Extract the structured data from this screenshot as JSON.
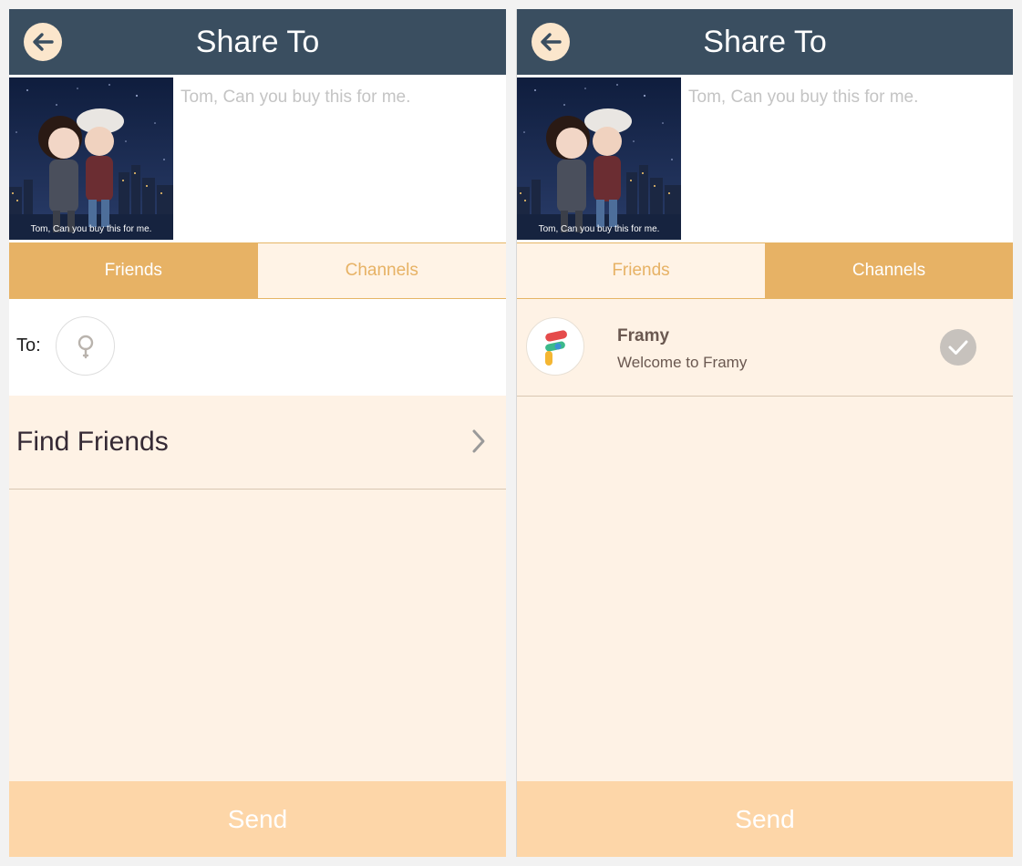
{
  "screens": [
    {
      "header": {
        "title": "Share To"
      },
      "preview": {
        "thumbnail_caption": "Tom, Can you buy this for me.",
        "message": "Tom, Can you buy this for me."
      },
      "tabs": [
        {
          "label": "Friends",
          "active": true
        },
        {
          "label": "Channels",
          "active": false
        }
      ],
      "to": {
        "label": "To:"
      },
      "find_friends": {
        "label": "Find Friends"
      },
      "send_label": "Send"
    },
    {
      "header": {
        "title": "Share To"
      },
      "preview": {
        "thumbnail_caption": "Tom, Can you buy this for me.",
        "message": "Tom, Can you buy this for me."
      },
      "tabs": [
        {
          "label": "Friends",
          "active": false
        },
        {
          "label": "Channels",
          "active": true
        }
      ],
      "channels": [
        {
          "name": "Framy",
          "subtitle": "Welcome to Framy",
          "selected": true,
          "icon": "framy-logo-icon"
        }
      ],
      "send_label": "Send"
    }
  ],
  "colors": {
    "header_bg": "#3a4e60",
    "accent": "#e7b265",
    "tab_inactive_bg": "#fff3e6",
    "content_bg": "#fef2e5",
    "send_bg": "#fdd6a8",
    "placeholder_text": "#c4c4c4"
  },
  "icons": {
    "back": "back-arrow-icon",
    "search": "search-icon",
    "chevron": "chevron-right-icon",
    "check": "check-icon"
  }
}
